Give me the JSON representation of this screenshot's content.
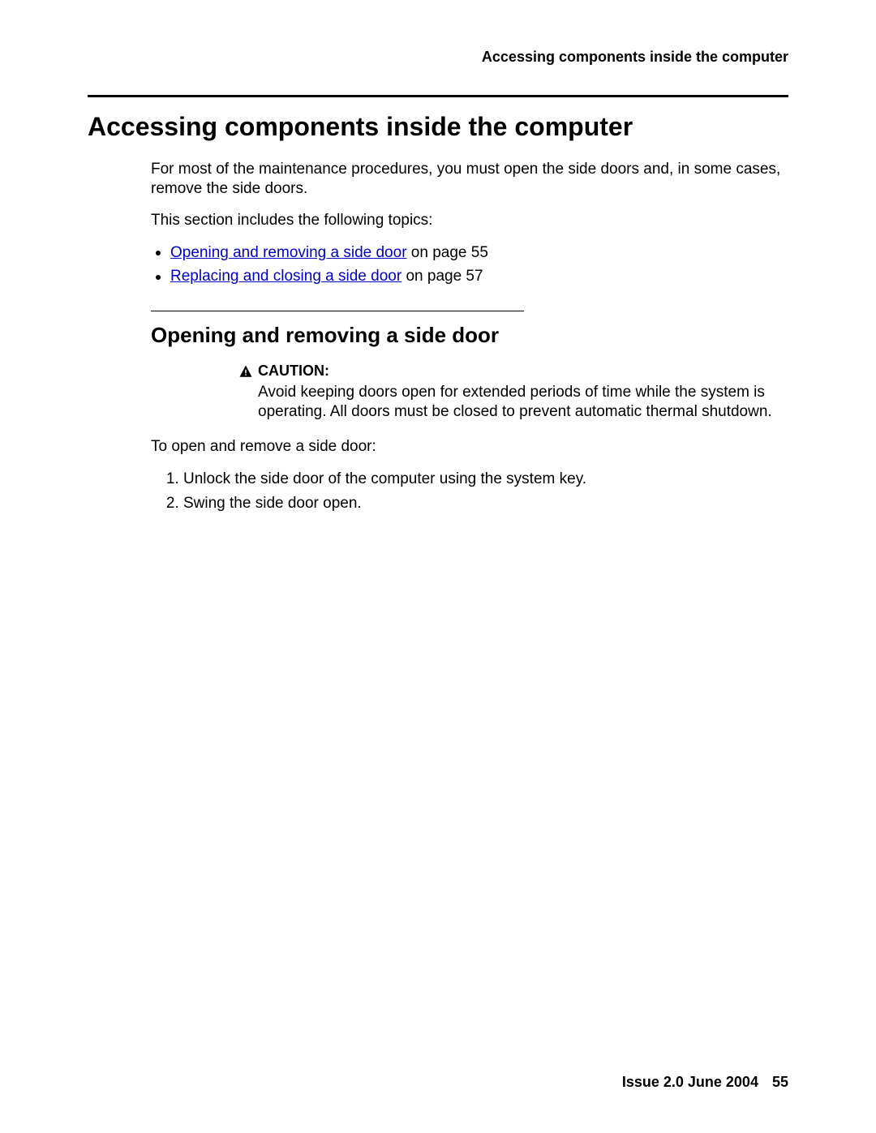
{
  "header": {
    "running_title": "Accessing components inside the computer"
  },
  "title": "Accessing components inside the computer",
  "intro": "For most of the maintenance procedures, you must open the side doors and, in some cases, remove the side doors.",
  "topics_intro": "This section includes the following topics:",
  "topics": [
    {
      "link": "Opening and removing a side door",
      "suffix": " on page 55"
    },
    {
      "link": "Replacing and closing a side door",
      "suffix": " on page 57"
    }
  ],
  "section": {
    "heading": "Opening and removing a side door",
    "caution_label": "CAUTION:",
    "caution_text": "Avoid keeping doors open for extended periods of time while the system is operating. All doors must be closed to prevent automatic thermal shutdown.",
    "lead": "To open and remove a side door:",
    "steps": [
      "Unlock the side door of the computer using the system key.",
      "Swing the side door open."
    ]
  },
  "footer": {
    "issue": "Issue 2.0   June 2004",
    "page": "55"
  }
}
